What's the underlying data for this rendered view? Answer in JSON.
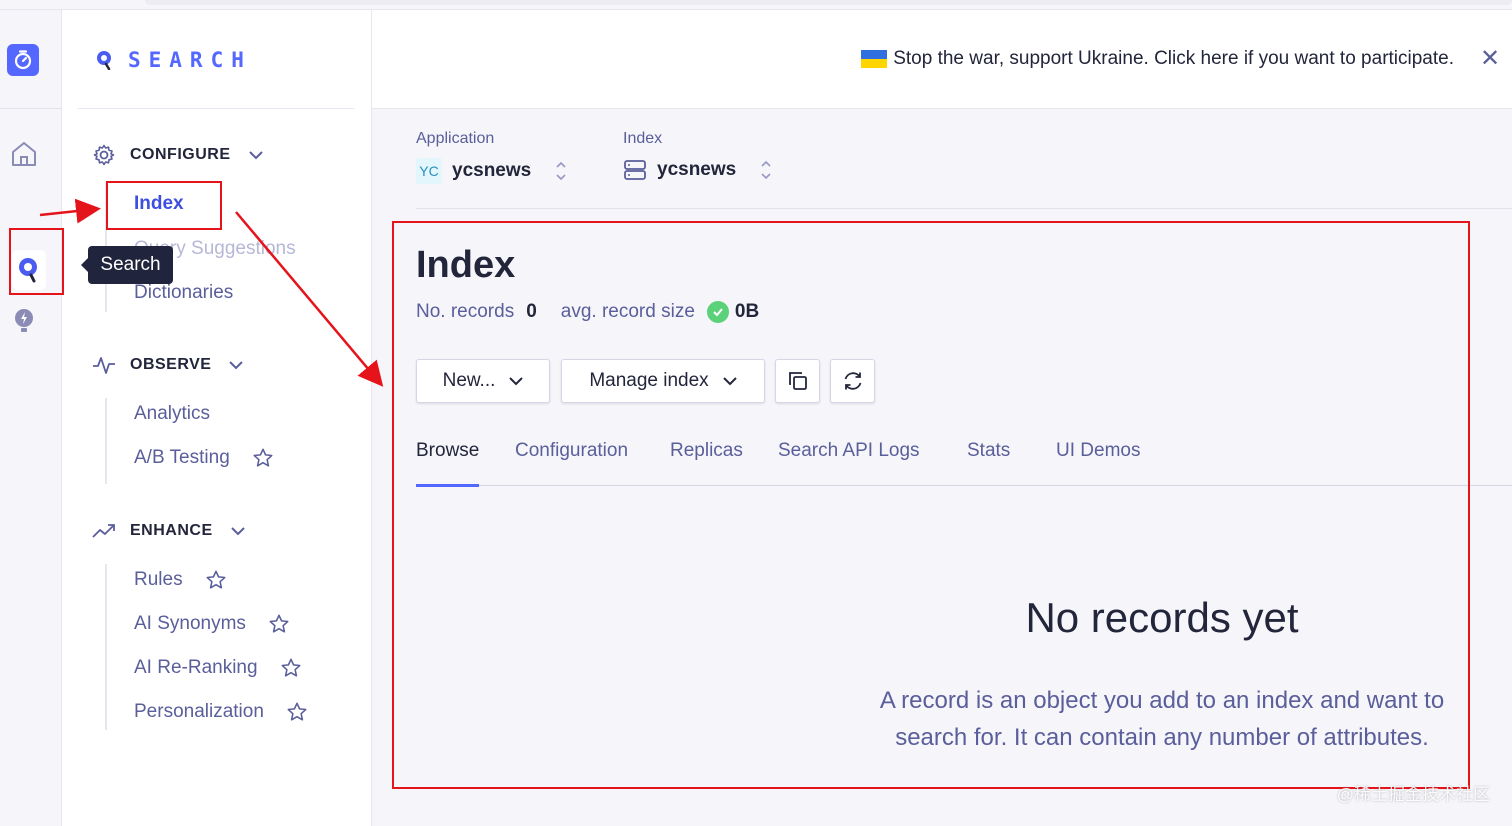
{
  "brand": {
    "name": "SEARCH"
  },
  "banner": {
    "message": "Stop the war, support Ukraine. Click here if you want to participate.",
    "close": "✕"
  },
  "context": {
    "application_label": "Application",
    "application_badge": "YC",
    "application_value": "ycsnews",
    "index_label": "Index",
    "index_value": "ycsnews"
  },
  "sidebar": {
    "configure": {
      "title": "CONFIGURE",
      "items": [
        "Index",
        "Query Suggestions",
        "Dictionaries"
      ]
    },
    "observe": {
      "title": "OBSERVE",
      "items": [
        "Analytics",
        "A/B Testing"
      ]
    },
    "enhance": {
      "title": "ENHANCE",
      "items": [
        "Rules",
        "AI Synonyms",
        "AI Re-Ranking",
        "Personalization"
      ]
    }
  },
  "tooltip": {
    "text": "Search"
  },
  "page": {
    "title": "Index",
    "records_label": "No. records",
    "records_value": "0",
    "size_label": "avg. record size",
    "size_value": "0B"
  },
  "toolbar": {
    "new_label": "New...",
    "manage_label": "Manage index"
  },
  "tabs": [
    "Browse",
    "Configuration",
    "Replicas",
    "Search API Logs",
    "Stats",
    "UI Demos"
  ],
  "active_tab": "Browse",
  "empty_state": {
    "title": "No records yet",
    "description": "A record is an object you add to an index and want to search for. It can contain any number of attributes."
  },
  "watermark": "@稀土掘金技术社区",
  "colors": {
    "accent": "#5468ff",
    "annotation": "#e5141b",
    "text": "#23263b",
    "muted": "#5a5e9a"
  }
}
